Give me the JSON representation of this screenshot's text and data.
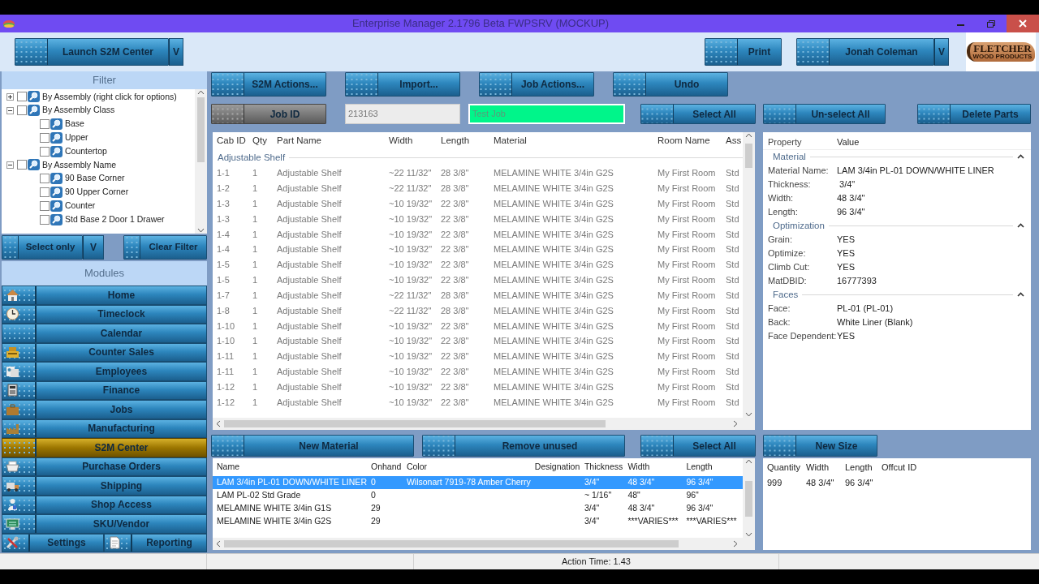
{
  "window": {
    "title": "Enterprise Manager 2.1796 Beta FWPSRV (MOCKUP)"
  },
  "toolbar": {
    "launch": {
      "label": "Launch S2M Center",
      "dropdown": "V"
    },
    "print": "Print",
    "user": {
      "label": "Jonah Coleman",
      "dropdown": "V"
    },
    "logo": {
      "name": "FLETCHER",
      "tagline": "WOOD PRODUCTS"
    }
  },
  "filter": {
    "title": "Filter",
    "tree": [
      {
        "label": "By Assembly (right click for options)",
        "checked": false,
        "expanded": false
      },
      {
        "label": "By Assembly Class",
        "checked": false,
        "expanded": true,
        "children": [
          {
            "label": "Base",
            "checked": false
          },
          {
            "label": "Upper",
            "checked": false
          },
          {
            "label": "Countertop",
            "checked": false
          }
        ]
      },
      {
        "label": "By Assembly Name",
        "checked": false,
        "expanded": true,
        "children": [
          {
            "label": "90 Base Corner",
            "checked": false
          },
          {
            "label": "90 Upper Corner",
            "checked": false
          },
          {
            "label": "Counter",
            "checked": false
          },
          {
            "label": "Std Base 2 Door 1 Drawer",
            "checked": false
          }
        ]
      }
    ],
    "select_only": {
      "label": "Select only",
      "dropdown": "V"
    },
    "clear": "Clear Filter"
  },
  "modules": {
    "title": "Modules",
    "items": [
      {
        "label": "Home",
        "selected": false
      },
      {
        "label": "Timeclock",
        "selected": false
      },
      {
        "label": "Calendar",
        "selected": false
      },
      {
        "label": "Counter Sales",
        "selected": false
      },
      {
        "label": "Employees",
        "selected": false
      },
      {
        "label": "Finance",
        "selected": false
      },
      {
        "label": "Jobs",
        "selected": false
      },
      {
        "label": "Manufacturing",
        "selected": false
      },
      {
        "label": "S2M Center",
        "selected": true
      },
      {
        "label": "Purchase Orders",
        "selected": false
      },
      {
        "label": "Shipping",
        "selected": false
      },
      {
        "label": "Shop Access",
        "selected": false
      },
      {
        "label": "SKU/Vendor",
        "selected": false
      }
    ],
    "settings": "Settings",
    "reporting": "Reporting"
  },
  "actions": [
    "S2M Actions...",
    "Import...",
    "Job Actions...",
    "Undo"
  ],
  "job": {
    "button": "Job ID",
    "job_id": "213163",
    "job_name": "Test Job",
    "select_all": "Select All",
    "unselect_all": "Un-select All",
    "delete": "Delete Parts"
  },
  "parts": {
    "columns": [
      "Cab ID",
      "Qty",
      "Part Name",
      "Width",
      "Length",
      "Material",
      "Room Name",
      "Ass"
    ],
    "group": "Adjustable Shelf",
    "rows": [
      [
        "1-1",
        "1",
        "Adjustable Shelf",
        "~22 11/32\"",
        "28 3/8\"",
        "MELAMINE WHITE 3/4in G2S",
        "My First Room",
        "Std"
      ],
      [
        "1-2",
        "1",
        "Adjustable Shelf",
        "~22 11/32\"",
        "28 3/8\"",
        "MELAMINE WHITE 3/4in G2S",
        "My First Room",
        "Std"
      ],
      [
        "1-3",
        "1",
        "Adjustable Shelf",
        "~10 19/32\"",
        "22 3/8\"",
        "MELAMINE WHITE 3/4in G2S",
        "My First Room",
        "Std"
      ],
      [
        "1-3",
        "1",
        "Adjustable Shelf",
        "~10 19/32\"",
        "22 3/8\"",
        "MELAMINE WHITE 3/4in G2S",
        "My First Room",
        "Std"
      ],
      [
        "1-4",
        "1",
        "Adjustable Shelf",
        "~10 19/32\"",
        "22 3/8\"",
        "MELAMINE WHITE 3/4in G2S",
        "My First Room",
        "Std"
      ],
      [
        "1-4",
        "1",
        "Adjustable Shelf",
        "~10 19/32\"",
        "22 3/8\"",
        "MELAMINE WHITE 3/4in G2S",
        "My First Room",
        "Std"
      ],
      [
        "1-5",
        "1",
        "Adjustable Shelf",
        "~10 19/32\"",
        "22 3/8\"",
        "MELAMINE WHITE 3/4in G2S",
        "My First Room",
        "Std"
      ],
      [
        "1-5",
        "1",
        "Adjustable Shelf",
        "~10 19/32\"",
        "22 3/8\"",
        "MELAMINE WHITE 3/4in G2S",
        "My First Room",
        "Std"
      ],
      [
        "1-7",
        "1",
        "Adjustable Shelf",
        "~22 11/32\"",
        "28 3/8\"",
        "MELAMINE WHITE 3/4in G2S",
        "My First Room",
        "Std"
      ],
      [
        "1-8",
        "1",
        "Adjustable Shelf",
        "~22 11/32\"",
        "28 3/8\"",
        "MELAMINE WHITE 3/4in G2S",
        "My First Room",
        "Std"
      ],
      [
        "1-10",
        "1",
        "Adjustable Shelf",
        "~10 19/32\"",
        "22 3/8\"",
        "MELAMINE WHITE 3/4in G2S",
        "My First Room",
        "Std"
      ],
      [
        "1-10",
        "1",
        "Adjustable Shelf",
        "~10 19/32\"",
        "22 3/8\"",
        "MELAMINE WHITE 3/4in G2S",
        "My First Room",
        "Std"
      ],
      [
        "1-11",
        "1",
        "Adjustable Shelf",
        "~10 19/32\"",
        "22 3/8\"",
        "MELAMINE WHITE 3/4in G2S",
        "My First Room",
        "Std"
      ],
      [
        "1-11",
        "1",
        "Adjustable Shelf",
        "~10 19/32\"",
        "22 3/8\"",
        "MELAMINE WHITE 3/4in G2S",
        "My First Room",
        "Std"
      ],
      [
        "1-12",
        "1",
        "Adjustable Shelf",
        "~10 19/32\"",
        "22 3/8\"",
        "MELAMINE WHITE 3/4in G2S",
        "My First Room",
        "Std"
      ],
      [
        "1-12",
        "1",
        "Adjustable Shelf",
        "~10 19/32\"",
        "22 3/8\"",
        "MELAMINE WHITE 3/4in G2S",
        "My First Room",
        "Std"
      ]
    ]
  },
  "properties": {
    "columns": [
      "Property",
      "Value"
    ],
    "sections": [
      {
        "title": "Material",
        "expanded": true,
        "rows": [
          [
            "Material Name:",
            "LAM 3/4in PL-01 DOWN/WHITE LINER"
          ],
          [
            "Thickness:",
            " 3/4\""
          ],
          [
            "Width:",
            "48 3/4\""
          ],
          [
            "Length:",
            "96 3/4\""
          ]
        ]
      },
      {
        "title": "Optimization",
        "expanded": true,
        "rows": [
          [
            "Grain:",
            "YES"
          ],
          [
            "Optimize:",
            "YES"
          ],
          [
            "Climb Cut:",
            "YES"
          ],
          [
            "MatDBID:",
            "16777393"
          ]
        ]
      },
      {
        "title": "Faces",
        "expanded": true,
        "rows": [
          [
            "Face:",
            "PL-01 (PL-01)"
          ],
          [
            "Back:",
            "White Liner (Blank)"
          ],
          [
            "Face Dependent:",
            "YES"
          ]
        ]
      }
    ]
  },
  "material_actions": [
    "New Material",
    "Remove unused",
    "Select All"
  ],
  "materials": {
    "columns": [
      "Name",
      "Onhand",
      "Color",
      "Designation",
      "Thickness",
      "Width",
      "Length"
    ],
    "rows": [
      {
        "cells": [
          "LAM 3/4in PL-01 DOWN/WHITE LINER",
          "0",
          "Wilsonart 7919-78 Amber Cherry",
          "",
          "3/4\"",
          "48 3/4\"",
          "96 3/4\""
        ],
        "selected": true
      },
      {
        "cells": [
          "LAM PL-02 Std Grade",
          "0",
          "",
          "",
          "~ 1/16\"",
          "48\"",
          "96\""
        ],
        "selected": false
      },
      {
        "cells": [
          "MELAMINE WHITE 3/4in G1S",
          "29",
          "",
          "",
          "3/4\"",
          "48 3/4\"",
          "96 3/4\""
        ],
        "selected": false
      },
      {
        "cells": [
          "MELAMINE WHITE 3/4in G2S",
          "29",
          "",
          "",
          "3/4\"",
          "***VARIES***",
          "***VARIES***"
        ],
        "selected": false
      }
    ]
  },
  "new_size": "New Size",
  "offcuts": {
    "columns": [
      "Quantity",
      "Width",
      "Length",
      "Offcut ID"
    ],
    "rows": [
      [
        "999",
        "48 3/4\"",
        "96 3/4\""
      ]
    ]
  },
  "status_bar": {
    "action_time": "Action Time: 1.43"
  }
}
